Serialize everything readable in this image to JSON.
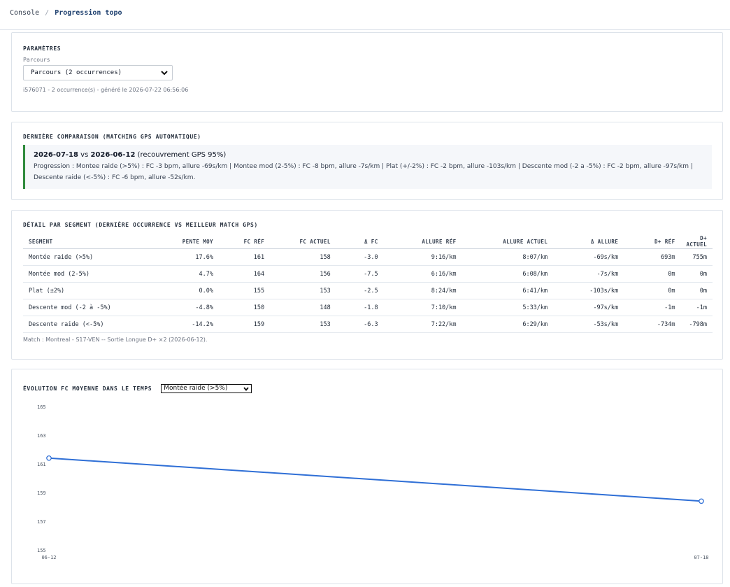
{
  "breadcrumb": {
    "root": "Console",
    "separator": "/",
    "current": "Progression topo"
  },
  "params": {
    "title": "PARAMÈTRES",
    "field_label": "Parcours",
    "selected": "Parcours (2 occurrences)",
    "meta": "i576071 - 2 occurrence(s) - généré le 2026-07-22 06:56:06"
  },
  "comparison": {
    "title": "DERNIÈRE COMPARAISON (MATCHING GPS AUTOMATIQUE)",
    "date_a": "2026-07-18",
    "vs": "vs",
    "date_b": "2026-06-12",
    "overlap": "(recouvrement GPS 95%)",
    "line1": "Progression : Montee raide (>5%) : FC -3 bpm, allure -69s/km | Montee mod (2-5%) : FC -8 bpm, allure -7s/km | Plat (+/-2%) : FC -2 bpm, allure -103s/km | Descente mod (-2 a -5%) : FC -2 bpm, allure -97s/km |",
    "line2": "Descente raide (<-5%) : FC -6 bpm, allure -52s/km."
  },
  "segments": {
    "title": "DÉTAIL PAR SEGMENT (DERNIÈRE OCCURRENCE VS MEILLEUR MATCH GPS)",
    "columns": [
      "SEGMENT",
      "PENTE MOY",
      "FC RÉF",
      "FC ACTUEL",
      "Δ FC",
      "ALLURE RÉF",
      "ALLURE ACTUEL",
      "Δ ALLURE",
      "D+ RÉF",
      "D+ ACTUEL"
    ],
    "rows": [
      [
        "Montée raide (>5%)",
        "17.6%",
        "161",
        "158",
        "-3.0",
        "9:16/km",
        "8:07/km",
        "-69s/km",
        "693m",
        "755m"
      ],
      [
        "Montée mod (2-5%)",
        "4.7%",
        "164",
        "156",
        "-7.5",
        "6:16/km",
        "6:08/km",
        "-7s/km",
        "0m",
        "0m"
      ],
      [
        "Plat (±2%)",
        "0.0%",
        "155",
        "153",
        "-2.5",
        "8:24/km",
        "6:41/km",
        "-103s/km",
        "0m",
        "0m"
      ],
      [
        "Descente mod (-2 à -5%)",
        "-4.8%",
        "150",
        "148",
        "-1.8",
        "7:10/km",
        "5:33/km",
        "-97s/km",
        "-1m",
        "-1m"
      ],
      [
        "Descente raide (<-5%)",
        "-14.2%",
        "159",
        "153",
        "-6.3",
        "7:22/km",
        "6:29/km",
        "-53s/km",
        "-734m",
        "-798m"
      ]
    ],
    "match_note": "Match : Montreal - S17-VEN -- Sortie Longue D+ ×2 (2026-06-12)."
  },
  "chart": {
    "title": "ÉVOLUTION FC MOYENNE DANS LE TEMPS",
    "selected": "Montée raide (>5%)"
  },
  "chart_data": {
    "type": "line",
    "title": "ÉVOLUTION FC MOYENNE DANS LE TEMPS",
    "x": [
      "06-12",
      "07-18"
    ],
    "series": [
      {
        "values": [
          161.4,
          158.4
        ]
      }
    ],
    "yticks": [
      165,
      163,
      161,
      159,
      157,
      155
    ],
    "ylim": [
      155,
      165
    ],
    "line_color": "#2f6fd6",
    "grid": false
  },
  "colors": {
    "positive": "#2f8a3c",
    "accent": "#1d3f6e",
    "line": "#2f6fd6"
  }
}
